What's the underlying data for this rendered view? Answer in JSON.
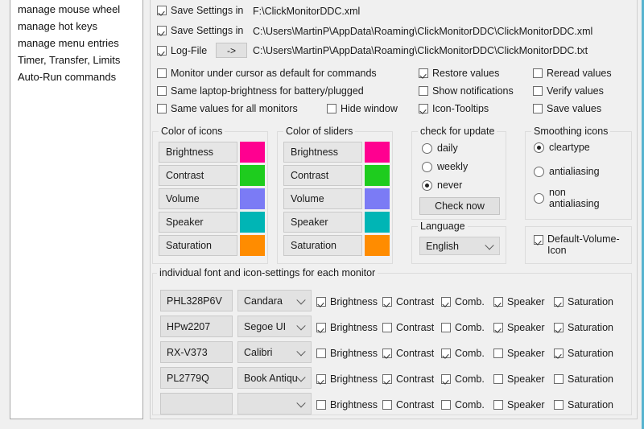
{
  "window": {
    "accent_color": "#57b4cf",
    "background": "#f0f0f0"
  },
  "sidebar": {
    "items": [
      {
        "label": "manage mouse wheel"
      },
      {
        "label": "manage hot keys"
      },
      {
        "label": "manage menu entries"
      },
      {
        "label": "Timer, Transfer, Limits"
      },
      {
        "label": "Auto-Run commands"
      }
    ]
  },
  "save_settings": {
    "rows": [
      {
        "label": "Save Settings in",
        "checked": true,
        "path": "F:\\ClickMonitorDDC.xml",
        "has_button": false
      },
      {
        "label": "Save Settings in",
        "checked": true,
        "path": "C:\\Users\\MartinP\\AppData\\Roaming\\ClickMonitorDDC\\ClickMonitorDDC.xml",
        "has_button": false
      },
      {
        "label": "Log-File",
        "checked": true,
        "path": "C:\\Users\\MartinP\\AppData\\Roaming\\ClickMonitorDDC\\ClickMonitorDDC.txt",
        "has_button": true,
        "button_label": "->"
      }
    ]
  },
  "options": {
    "col1": [
      {
        "label": "Monitor under cursor as default for commands",
        "checked": false
      },
      {
        "label": "Same laptop-brightness for battery/plugged",
        "checked": false
      },
      {
        "label": "Same values for all monitors",
        "checked": false
      }
    ],
    "hide_window": {
      "label": "Hide window",
      "checked": false
    },
    "col2": [
      {
        "label": "Restore values",
        "checked": true
      },
      {
        "label": "Show notifications",
        "checked": false
      },
      {
        "label": "Icon-Tooltips",
        "checked": true
      }
    ],
    "col3": [
      {
        "label": "Reread values",
        "checked": false
      },
      {
        "label": "Verify values",
        "checked": false
      },
      {
        "label": "Save values",
        "checked": false
      }
    ]
  },
  "color_of_icons": {
    "caption": "Color of icons",
    "rows": [
      {
        "label": "Brightness",
        "color": "#ff0090"
      },
      {
        "label": "Contrast",
        "color": "#1ecc1e"
      },
      {
        "label": "Volume",
        "color": "#7b7bf5"
      },
      {
        "label": "Speaker",
        "color": "#00b5b5"
      },
      {
        "label": "Saturation",
        "color": "#ff8c00"
      }
    ]
  },
  "color_of_sliders": {
    "caption": "Color of sliders",
    "rows": [
      {
        "label": "Brightness",
        "color": "#ff0090"
      },
      {
        "label": "Contrast",
        "color": "#1ecc1e"
      },
      {
        "label": "Volume",
        "color": "#7b7bf5"
      },
      {
        "label": "Speaker",
        "color": "#00b5b5"
      },
      {
        "label": "Saturation",
        "color": "#ff8c00"
      }
    ]
  },
  "check_for_update": {
    "caption": "check for update",
    "options": [
      {
        "label": "daily",
        "selected": false
      },
      {
        "label": "weekly",
        "selected": false
      },
      {
        "label": "never",
        "selected": true
      }
    ],
    "button_label": "Check now"
  },
  "language": {
    "caption": "Language",
    "selected": "English"
  },
  "smoothing_icons": {
    "caption": "Smoothing icons",
    "options": [
      {
        "label": "cleartype",
        "selected": true
      },
      {
        "label": "antialiasing",
        "selected": false
      },
      {
        "label": "non antialiasing",
        "selected": false,
        "line1": "non",
        "line2": "antialiasing"
      }
    ]
  },
  "default_volume_icon": {
    "label_line1": "Default-Volume-",
    "label_line2": "Icon",
    "checked": true
  },
  "monitor_settings": {
    "caption": "individual font and icon-settings for each monitor",
    "column_labels": [
      "Brightness",
      "Contrast",
      "Comb.",
      "Speaker",
      "Saturation"
    ],
    "rows": [
      {
        "monitor": "PHL328P6V",
        "font": "Candara",
        "brightness": true,
        "contrast": true,
        "comb": true,
        "speaker": true,
        "saturation": true
      },
      {
        "monitor": "HPw2207",
        "font": "Segoe UI",
        "brightness": true,
        "contrast": false,
        "comb": false,
        "speaker": true,
        "saturation": true
      },
      {
        "monitor": "RX-V373",
        "font": "Calibri",
        "brightness": false,
        "contrast": true,
        "comb": true,
        "speaker": false,
        "saturation": true
      },
      {
        "monitor": "PL2779Q",
        "font": "Book Antiqua",
        "brightness": true,
        "contrast": true,
        "comb": true,
        "speaker": false,
        "saturation": false
      },
      {
        "monitor": "",
        "font": "",
        "brightness": false,
        "contrast": false,
        "comb": false,
        "speaker": false,
        "saturation": false
      }
    ]
  }
}
